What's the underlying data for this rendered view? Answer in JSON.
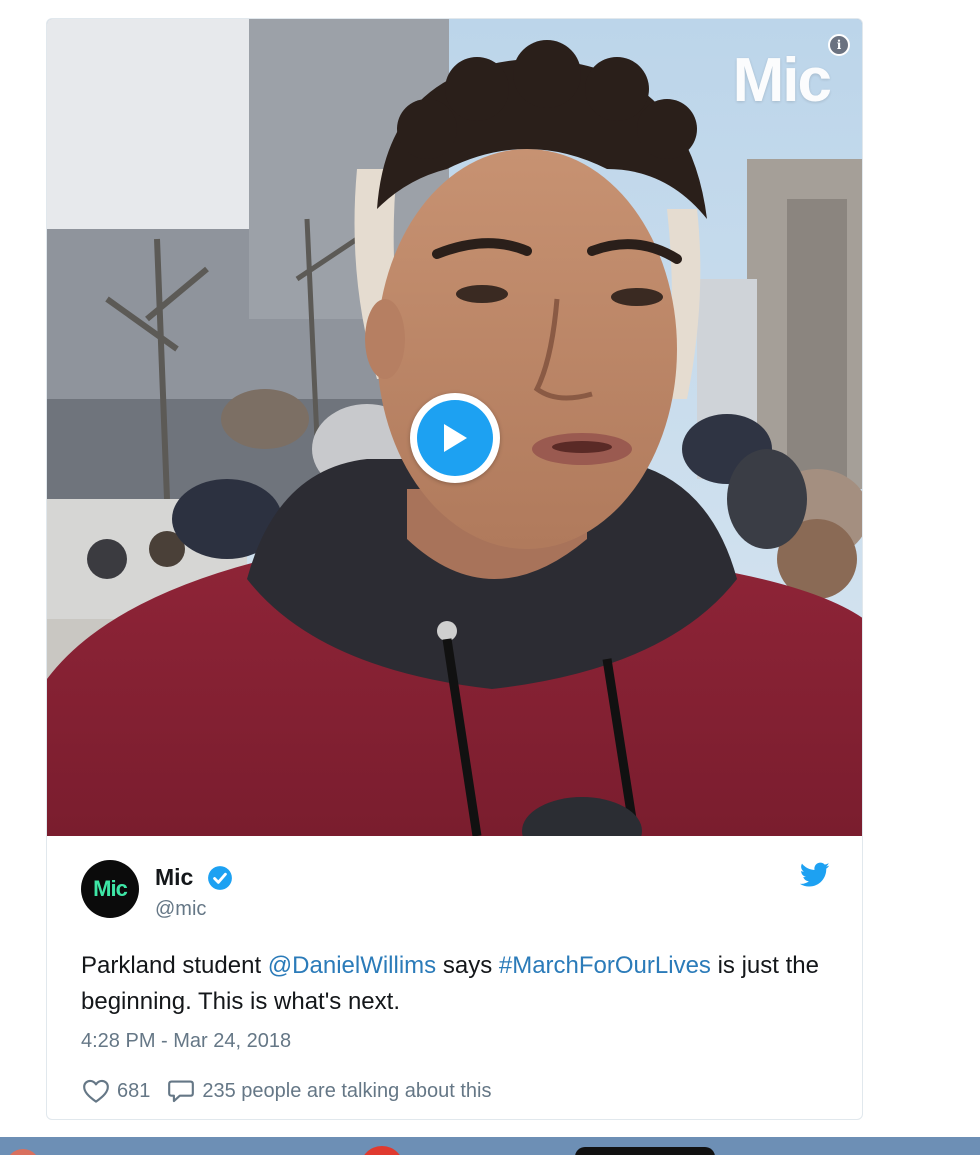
{
  "media": {
    "watermark": "Mic",
    "info_icon": "info-icon",
    "play_icon": "play-icon"
  },
  "tweet": {
    "avatar_text": "Mic",
    "display_name": "Mic",
    "handle": "@mic",
    "text_before": "Parkland student ",
    "mention": "@DanielWillims",
    "text_middle": " says ",
    "hashtag": "#MarchForOurLives",
    "text_after": " is just the beginning. This is what's next.",
    "timestamp": "4:28 PM - Mar 24, 2018",
    "likes": "681",
    "talking": "235 people are talking about this"
  },
  "colors": {
    "accent": "#1da1f2",
    "link": "#2b7bb9",
    "muted": "#657786",
    "avatar_bg": "#0b0b0b",
    "avatar_text": "#3ee6a6"
  }
}
